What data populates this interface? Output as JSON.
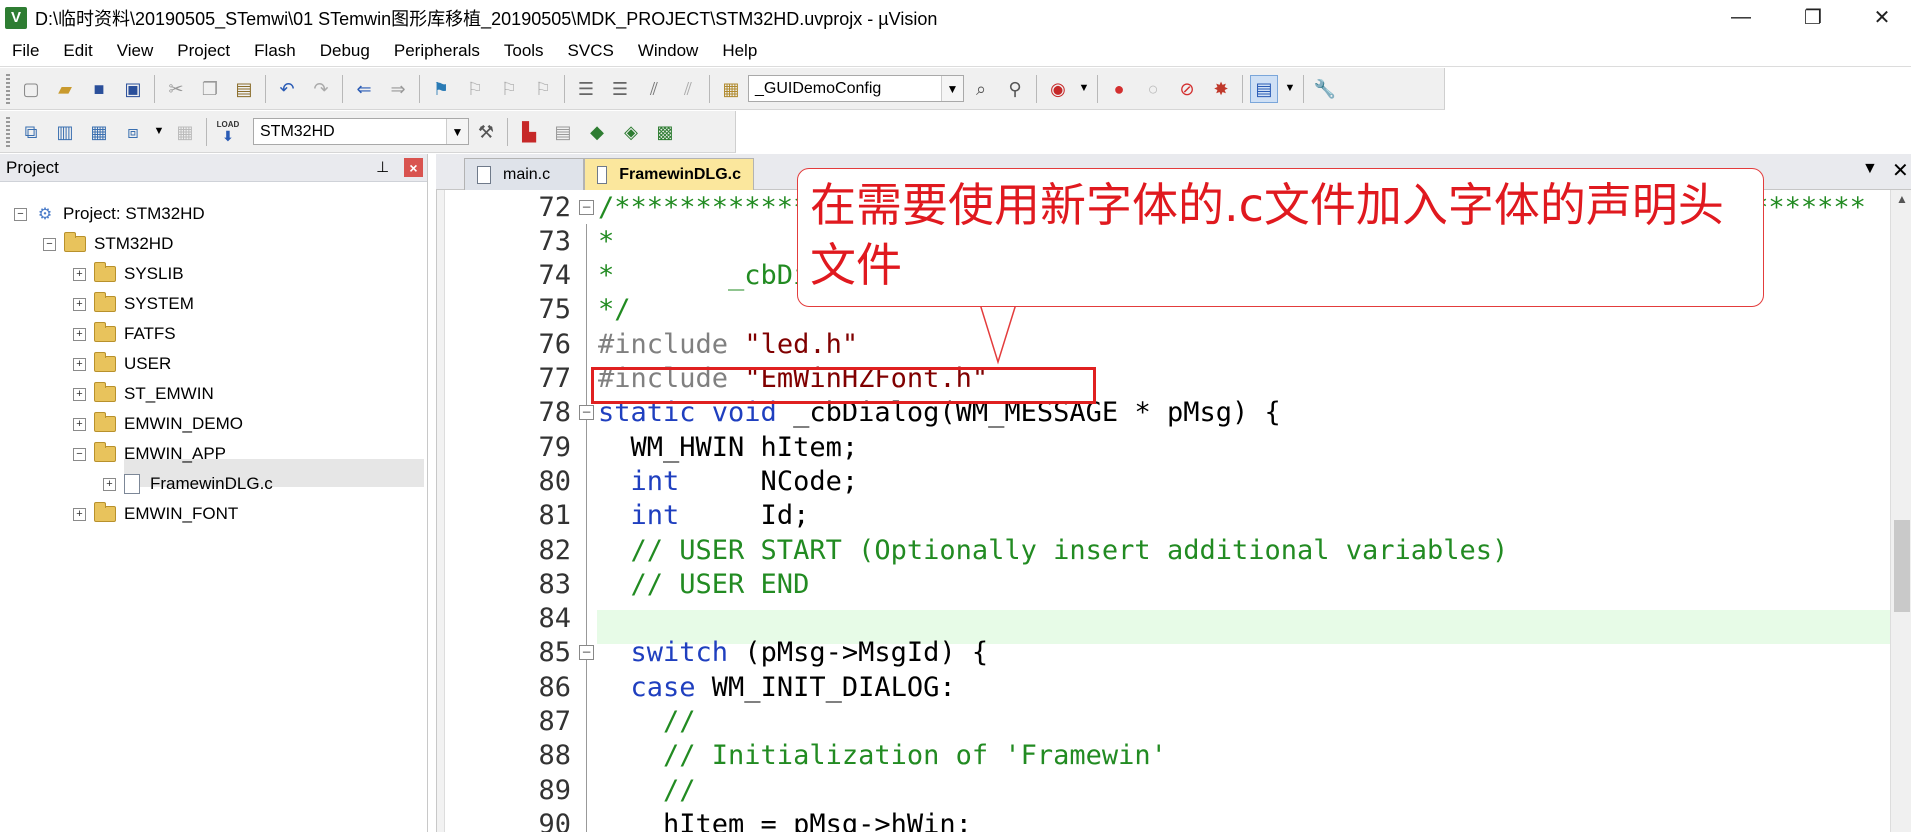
{
  "window": {
    "app_icon": "V",
    "title": "D:\\临时资料\\20190505_STemwi\\01 STemwin图形库移植_20190505\\MDK_PROJECT\\STM32HD.uvprojx - µVision",
    "min_glyph": "—",
    "max_glyph": "❐",
    "close_glyph": "✕"
  },
  "menu": [
    "File",
    "Edit",
    "View",
    "Project",
    "Flash",
    "Debug",
    "Peripherals",
    "Tools",
    "SVCS",
    "Window",
    "Help"
  ],
  "toolbar1": {
    "target_combo": "_GUIDemoConfig"
  },
  "toolbar2": {
    "target_combo": "STM32HD",
    "load_label": "LOAD"
  },
  "project_panel": {
    "title": "Project",
    "pin": "⊥",
    "close": "×",
    "tree": [
      {
        "label": "Project: STM32HD",
        "expander": "−"
      },
      {
        "label": "STM32HD",
        "expander": "−"
      },
      {
        "label": "SYSLIB",
        "expander": "+"
      },
      {
        "label": "SYSTEM",
        "expander": "+"
      },
      {
        "label": "FATFS",
        "expander": "+"
      },
      {
        "label": "USER",
        "expander": "+"
      },
      {
        "label": "ST_EMWIN",
        "expander": "+"
      },
      {
        "label": "EMWIN_DEMO",
        "expander": "+"
      },
      {
        "label": "EMWIN_APP",
        "expander": "−"
      },
      {
        "label": "FramewinDLG.c",
        "expander": "+"
      },
      {
        "label": "EMWIN_FONT",
        "expander": "+"
      }
    ]
  },
  "tabs": [
    {
      "label": "main.c"
    },
    {
      "label": "FramewinDLG.c"
    }
  ],
  "code_lines": [
    {
      "num": "72",
      "fold": "−",
      "segments": [
        {
          "cls": "cm",
          "text": "/*****************************************************************************"
        }
      ]
    },
    {
      "num": "73",
      "fold": "",
      "segments": [
        {
          "cls": "cm",
          "text": "*"
        }
      ]
    },
    {
      "num": "74",
      "fold": "",
      "segments": [
        {
          "cls": "cm",
          "text": "*       _cbDialog"
        }
      ]
    },
    {
      "num": "75",
      "fold": "",
      "segments": [
        {
          "cls": "cm",
          "text": "*/"
        }
      ]
    },
    {
      "num": "76",
      "fold": "",
      "segments": [
        {
          "cls": "pp",
          "text": "#include "
        },
        {
          "cls": "st",
          "text": "\"led.h\""
        }
      ]
    },
    {
      "num": "77",
      "fold": "",
      "segments": [
        {
          "cls": "pp",
          "text": "#include "
        },
        {
          "cls": "st",
          "text": "\"EmWinHZFont.h\""
        }
      ]
    },
    {
      "num": "78",
      "fold": "−",
      "segments": [
        {
          "cls": "kw",
          "text": "static void "
        },
        {
          "cls": "tx",
          "text": "_cbDialog(WM_MESSAGE * pMsg) {"
        }
      ]
    },
    {
      "num": "79",
      "fold": "",
      "segments": [
        {
          "cls": "tx",
          "text": "  WM_HWIN hItem;"
        }
      ]
    },
    {
      "num": "80",
      "fold": "",
      "segments": [
        {
          "cls": "kw",
          "text": "  int"
        },
        {
          "cls": "tx",
          "text": "     NCode;"
        }
      ]
    },
    {
      "num": "81",
      "fold": "",
      "segments": [
        {
          "cls": "kw",
          "text": "  int"
        },
        {
          "cls": "tx",
          "text": "     Id;"
        }
      ]
    },
    {
      "num": "82",
      "fold": "",
      "segments": [
        {
          "cls": "cm",
          "text": "  // USER START (Optionally insert additional variables)"
        }
      ]
    },
    {
      "num": "83",
      "fold": "",
      "segments": [
        {
          "cls": "cm",
          "text": "  // USER END"
        }
      ]
    },
    {
      "num": "84",
      "fold": "",
      "segments": [
        {
          "cls": "tx",
          "text": ""
        }
      ]
    },
    {
      "num": "85",
      "fold": "−",
      "segments": [
        {
          "cls": "kw",
          "text": "  switch "
        },
        {
          "cls": "tx",
          "text": "(pMsg->MsgId) {"
        }
      ]
    },
    {
      "num": "86",
      "fold": "",
      "segments": [
        {
          "cls": "kw",
          "text": "  case "
        },
        {
          "cls": "tx",
          "text": "WM_INIT_DIALOG:"
        }
      ]
    },
    {
      "num": "87",
      "fold": "",
      "segments": [
        {
          "cls": "cm",
          "text": "    //"
        }
      ]
    },
    {
      "num": "88",
      "fold": "",
      "segments": [
        {
          "cls": "cm",
          "text": "    // Initialization of 'Framewin'"
        }
      ]
    },
    {
      "num": "89",
      "fold": "",
      "segments": [
        {
          "cls": "cm",
          "text": "    //"
        }
      ]
    },
    {
      "num": "90",
      "fold": "",
      "segments": [
        {
          "cls": "tx",
          "text": "    hItem = pMsg->hWin;"
        }
      ]
    }
  ],
  "callout": {
    "text": "在需要使用新字体的.c文件加入字体的声明头文件"
  },
  "colors": {
    "comment": "#228b22",
    "keyword": "#1f3fbf",
    "preprocessor": "#808080",
    "string": "#800000",
    "callout_red": "#e0191f",
    "active_tab": "#fbe79d",
    "current_line": "#e7fbe7"
  }
}
